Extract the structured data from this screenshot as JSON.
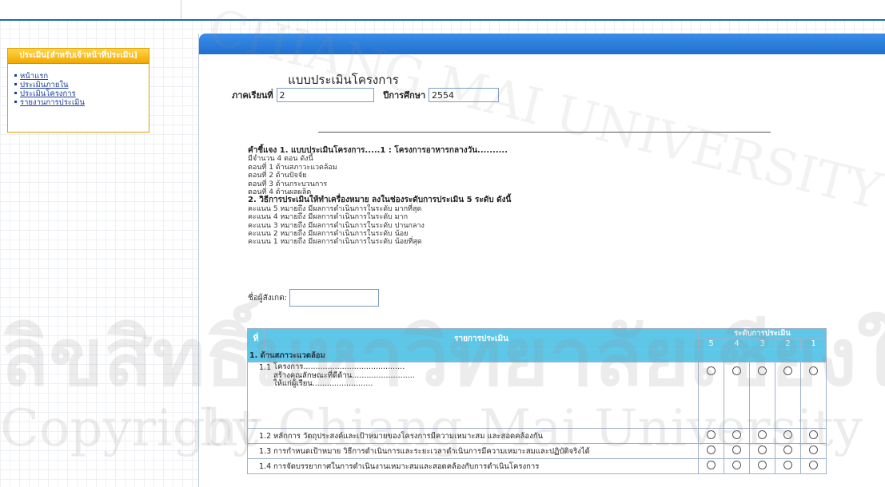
{
  "sidebar": {
    "header": "ประเมิน[สำหรับเจ้าหน้าที่ประเมิน]",
    "items": [
      {
        "label": "หน้าแรก"
      },
      {
        "label": "ประเมินภายใน"
      },
      {
        "label": "ประเมินโครงการ"
      },
      {
        "label": "รายงานการประเมิน"
      }
    ]
  },
  "form": {
    "title": "แบบประเมินโครงการ",
    "term_label": "ภาคเรียนที่",
    "term_value": "2",
    "year_label": "ปีการศึกษา",
    "year_value": "2554"
  },
  "instructions": {
    "heading1": "คำชี้แจง 1. แบบประเมินโครงการ.....1 : โครงการอาหารกลางวัน..........",
    "parts_intro": "มีจำนวน 4 ตอน ดังนี้",
    "parts": [
      "ตอนที่ 1 ด้านสภาวะแวดล้อม",
      "ตอนที่ 2 ด้านปัจจัย",
      "ตอนที่ 3 ด้านกระบวนการ",
      "ตอนที่ 4 ด้านผลผลิต"
    ],
    "heading2": "2. วิธีการประเมินให้ทำเครื่องหมาย ลงในช่องระดับการประเมิน 5 ระดับ ดังนี้",
    "scores": [
      "คะแนน 5 หมายถึง มีผลการดำเนินการในระดับ มากที่สุด",
      "คะแนน 4 หมายถึง มีผลการดำเนินการในระดับ มาก",
      "คะแนน 3 หมายถึง มีผลการดำเนินการในระดับ ปานกลาง",
      "คะแนน 2 หมายถึง มีผลการดำเนินการในระดับ น้อย",
      "คะแนน 1 หมายถึง มีผลการดำเนินการในระดับ น้อยที่สุด"
    ]
  },
  "observer": {
    "label": "ชื่อผู้สังเกต:",
    "value": ""
  },
  "table": {
    "col_no": "ที่",
    "col_item": "รายการประเมิน",
    "col_level": "ระดับการประเมิน",
    "levels": [
      "5",
      "4",
      "3",
      "2",
      "1"
    ],
    "section1": "1. ด้านสภาวะแวดล้อม",
    "rows": [
      {
        "no": "1.1",
        "lines": [
          "โครงการ..........................................",
          "สร้างคุณลักษณะที่ดีด้าน..........................",
          "ให้แก่ผู้เรียน........................."
        ]
      },
      {
        "no": "1.2",
        "lines": [
          "หลักการ วัตถุประสงค์และเป้าหมายของโครงการมีความเหมาะสม และสอดคล้องกัน"
        ]
      },
      {
        "no": "1.3",
        "lines": [
          "การกำหนดเป้าหมาย วิธีการดำเนินการและระยะเวลาดำเนินการมีความเหมาะสมและปฏิบัติจริงได้"
        ]
      },
      {
        "no": "1.4",
        "lines": [
          "การจัดบรรยากาศในการดำเนินงานเหมาะสมและสอดคล้องกับการดำเนินโครงการ"
        ]
      }
    ]
  },
  "watermark": {
    "big": "ลิขสิทธิ์มหาวิทยาลัยเชียงใหม่",
    "line1": "Copyright",
    "line2": "by Chiang Mai University",
    "arc": "CHIANG MAI UNIVERSITY"
  }
}
